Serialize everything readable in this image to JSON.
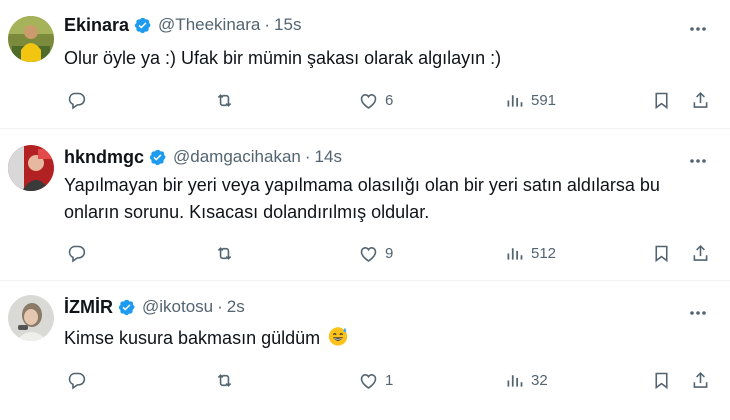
{
  "tweets": [
    {
      "name": "Ekinara",
      "handle": "@Theekinara",
      "time": "15s",
      "text": "Olur öyle ya :) Ufak bir mümin şakası olarak algılayın :)",
      "likes": "6",
      "views": "591"
    },
    {
      "name": "hkndmgc",
      "handle": "@damgacihakan",
      "time": "14s",
      "text": "Yapılmayan bir yeri veya yapılmama olasılığı olan bir yeri satın aldılarsa bu onların sorunu. Kısacası dolandırılmış oldular.",
      "likes": "9",
      "views": "512"
    },
    {
      "name": "İZMİR",
      "handle": "@ikotosu",
      "time": "2s",
      "text": "Kimse kusura bakmasın güldüm",
      "emoji": "sweat-smile-emoji",
      "likes": "1",
      "views": "32"
    }
  ],
  "separator": "·",
  "colors": {
    "verified": "#1d9bf0",
    "muted": "#536471",
    "text": "#0f1419"
  }
}
